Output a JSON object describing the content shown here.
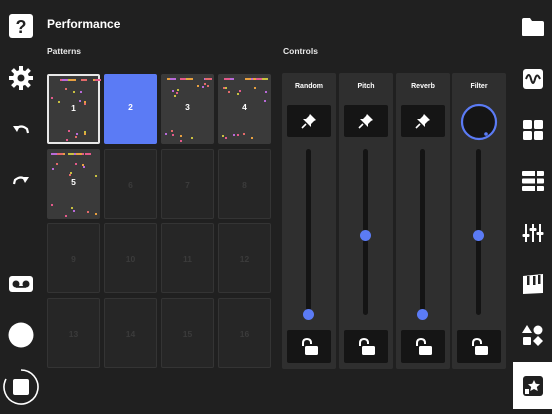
{
  "header": {
    "title": "Performance"
  },
  "sections": {
    "patterns": "Patterns",
    "controls": "Controls"
  },
  "left_toolbar": [
    {
      "icon": "help-icon"
    },
    {
      "icon": "gear-icon"
    },
    {
      "icon": "undo-icon"
    },
    {
      "icon": "redo-icon"
    },
    {
      "icon": "tape-icon"
    },
    {
      "icon": "record-icon"
    },
    {
      "icon": "stop-icon"
    }
  ],
  "right_toolbar": [
    {
      "icon": "folder-icon"
    },
    {
      "icon": "waveform-icon"
    },
    {
      "icon": "grid-icon"
    },
    {
      "icon": "tracks-icon"
    },
    {
      "icon": "mixer-icon"
    },
    {
      "icon": "keys-icon"
    },
    {
      "icon": "shapes-icon"
    },
    {
      "icon": "performance-icon",
      "selected": true
    }
  ],
  "patterns": [
    {
      "label": "1",
      "filled": true,
      "selected": true
    },
    {
      "label": "2",
      "filled": true,
      "active": true
    },
    {
      "label": "3",
      "filled": true
    },
    {
      "label": "4",
      "filled": true
    },
    {
      "label": "5",
      "filled": true
    },
    {
      "label": "6"
    },
    {
      "label": "7"
    },
    {
      "label": "8"
    },
    {
      "label": "9"
    },
    {
      "label": "10"
    },
    {
      "label": "11"
    },
    {
      "label": "12"
    },
    {
      "label": "13"
    },
    {
      "label": "14"
    },
    {
      "label": "15"
    },
    {
      "label": "16"
    }
  ],
  "controls": [
    {
      "label": "Random",
      "slider_level": 0.0,
      "type": "slider"
    },
    {
      "label": "Pitch",
      "slider_level": 0.5,
      "type": "slider"
    },
    {
      "label": "Reverb",
      "slider_level": 0.0,
      "type": "slider"
    },
    {
      "label": "Filter",
      "slider_level": 0.5,
      "type": "knob"
    }
  ],
  "colors": {
    "accent": "#5b7bf5",
    "background": "#202020",
    "panel": "#2f2f2f"
  }
}
